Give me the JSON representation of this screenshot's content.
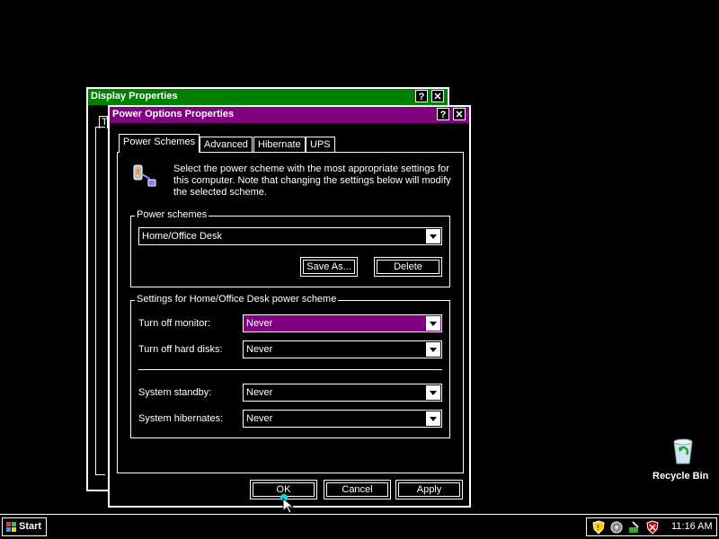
{
  "colors": {
    "background": "#000000",
    "display_title_bg": "#008000",
    "power_title_bg": "#800080",
    "selected_combo_bg": "#800080",
    "taskbar_text": "#ffffff"
  },
  "display_window": {
    "title": "Display Properties",
    "help_label": "?",
    "close_label": "✕",
    "tab_stub": "T"
  },
  "power_window": {
    "title": "Power Options Properties",
    "help_label": "?",
    "close_label": "✕",
    "tabs": [
      "Power Schemes",
      "Advanced",
      "Hibernate",
      "UPS"
    ],
    "active_tab": 0,
    "description": {
      "line1": "Select the power scheme with the most appropriate settings for",
      "line2": "this computer. Note that changing the settings below will modify",
      "line3": "the selected scheme."
    },
    "schemes_group": {
      "legend": "Power schemes",
      "selected": "Home/Office Desk",
      "save_as_label": "Save As...",
      "delete_label": "Delete"
    },
    "settings_group": {
      "legend": "Settings for Home/Office Desk power scheme",
      "rows": [
        {
          "label": "Turn off monitor:",
          "value": "Never"
        },
        {
          "label": "Turn off hard disks:",
          "value": "Never"
        },
        {
          "label": "System standby:",
          "value": "Never"
        },
        {
          "label": "System hibernates:",
          "value": "Never"
        }
      ]
    },
    "buttons": {
      "ok": "OK",
      "cancel": "Cancel",
      "apply": "Apply"
    },
    "icon": "power-plug-icon"
  },
  "desktop": {
    "recycle_bin_label": "Recycle Bin",
    "recycle_bin_icon": "recycle-bin-icon"
  },
  "taskbar": {
    "start_label": "Start",
    "tray_icons": [
      "security-shield-icon",
      "network-icon",
      "safely-remove-icon",
      "security-alert-icon"
    ],
    "clock": "11:16 AM"
  }
}
